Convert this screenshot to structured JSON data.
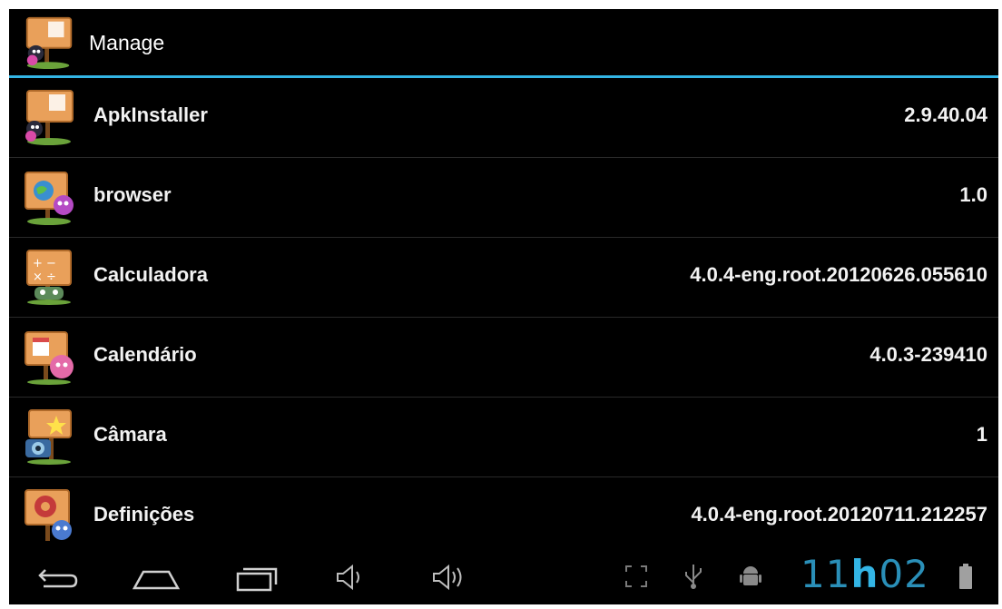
{
  "action_bar": {
    "title": "Manage",
    "icon": "apkinstaller-app-icon"
  },
  "apps": [
    {
      "name": "ApkInstaller",
      "version": "2.9.40.04",
      "icon": "apkinstaller-app-icon"
    },
    {
      "name": "browser",
      "version": "1.0",
      "icon": "browser-app-icon"
    },
    {
      "name": "Calculadora",
      "version": "4.0.4-eng.root.20120626.055610",
      "icon": "calculator-app-icon"
    },
    {
      "name": "Calendário",
      "version": "4.0.3-239410",
      "icon": "calendar-app-icon"
    },
    {
      "name": "Câmara",
      "version": "1",
      "icon": "camera-app-icon"
    },
    {
      "name": "Definições",
      "version": "4.0.4-eng.root.20120711.212257",
      "icon": "settings-app-icon"
    }
  ],
  "system_bar": {
    "nav_buttons": [
      "back-icon",
      "home-icon",
      "recent-apps-icon",
      "volume-down-icon",
      "volume-up-icon"
    ],
    "status_icons": [
      "fullscreen-icon",
      "usb-icon",
      "android-debug-icon",
      "battery-icon"
    ],
    "clock_hours": "11",
    "clock_separator": "h",
    "clock_minutes": "02"
  },
  "colors": {
    "accent": "#33b5e5",
    "background": "#000000",
    "text": "#f2f2f2",
    "signpost": "#e9a05a"
  }
}
